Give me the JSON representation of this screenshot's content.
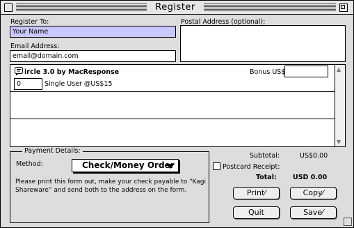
{
  "window": {
    "title": "Register"
  },
  "register_to": {
    "label": "Register To:",
    "value": "Your Name"
  },
  "email": {
    "label": "Email Address:",
    "value": "email@domain.com"
  },
  "postal": {
    "label": "Postal Address (optional):",
    "value": ""
  },
  "product": {
    "name": "ircle 3.0 by MacResponse",
    "bonus_label": "Bonus US$",
    "bonus_value": "",
    "quantity": "0",
    "license_label": "Single User @US$15"
  },
  "payment": {
    "legend": "Payment Details:",
    "method_label": "Method:",
    "method_value": "Check/Money Order",
    "note": "Please print this form out, make your check payable to “Kagi Shareware” and send both to the address on the form."
  },
  "totals": {
    "subtotal_label": "Subtotal:",
    "subtotal_value": "US$0.00",
    "postcard_label": "Postcard Receipt:",
    "total_label": "Total:",
    "total_value": "USD 0.00"
  },
  "buttons": {
    "print": "Print⁄",
    "copy": "Copy⁄",
    "quit": "Quit",
    "save": "Save⁄"
  },
  "icons": {
    "product": "ircle-icon"
  }
}
